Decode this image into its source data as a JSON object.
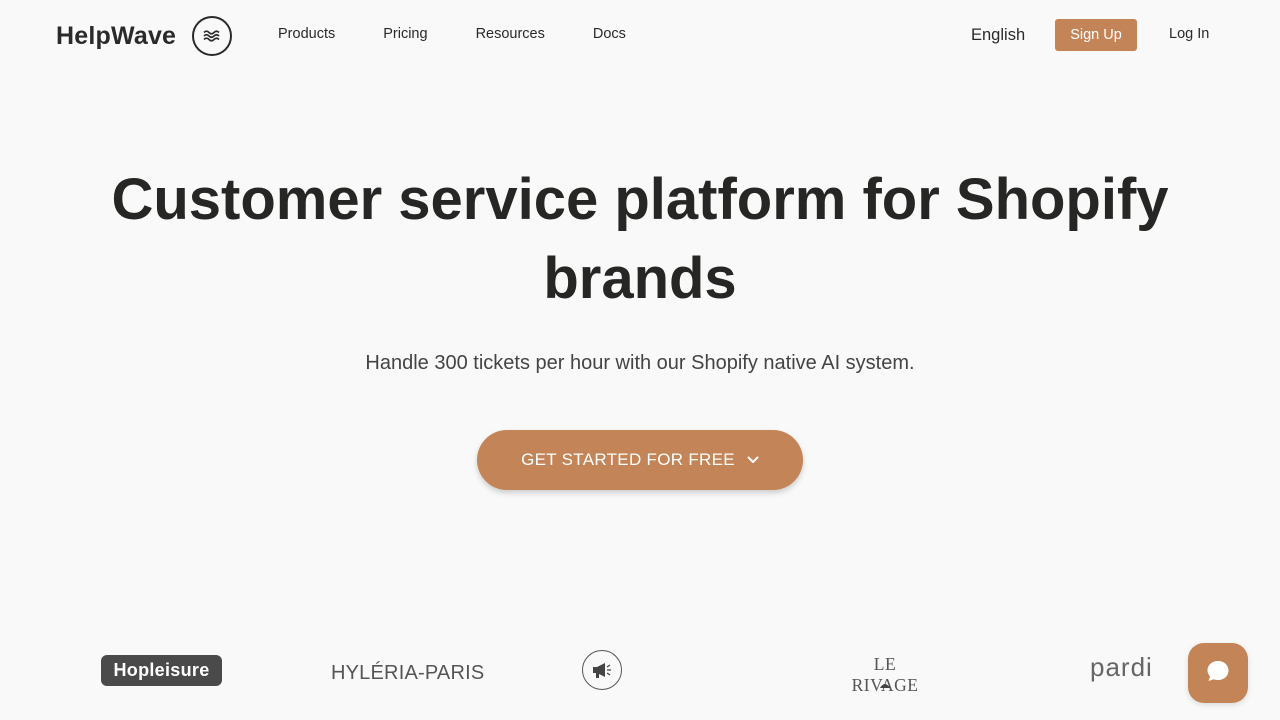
{
  "nav": {
    "brand": "HelpWave",
    "brand_icon": "waves-icon",
    "links": [
      "Products",
      "Pricing",
      "Resources",
      "Docs"
    ],
    "language": "English",
    "signup": "Sign Up",
    "login": "Log In"
  },
  "hero": {
    "title": "Customer service platform for Shopify brands",
    "subtitle": "Handle 300 tickets per hour with our Shopify native AI system.",
    "cta": "GET STARTED FOR FREE",
    "cta_icon": "chevron-down-icon"
  },
  "logos": {
    "items": [
      "Hopleisure",
      "HYLÉRIA-PARIS",
      "megaphone-logo",
      "LE RIVAGE",
      "pardi"
    ]
  },
  "chat": {
    "icon": "chat-bubble-icon"
  },
  "colors": {
    "accent": "#c38557",
    "background": "#f9f9f9",
    "text": "#262624"
  }
}
